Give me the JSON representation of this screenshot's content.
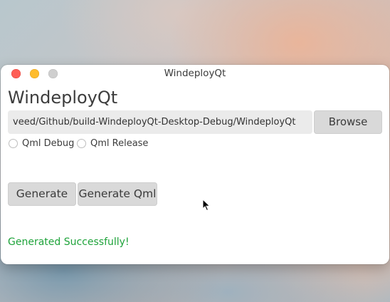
{
  "window": {
    "title": "WindeployQt",
    "controls": {
      "close": "close-icon",
      "minimize": "minimize-icon",
      "maximize": "maximize-icon"
    }
  },
  "main": {
    "heading": "WindeployQt",
    "path_value": "veed/Github/build-WindeployQt-Desktop-Debug/WindeployQt",
    "browse_label": "Browse",
    "options": [
      {
        "label": "Qml Debug",
        "checked": false
      },
      {
        "label": "Qml Release",
        "checked": false
      }
    ],
    "generate_label": "Generate",
    "generate_qml_label": "Generate Qml",
    "status_text": "Generated Successfully!"
  },
  "colors": {
    "close": "#fe5f57",
    "minimize": "#febc2e",
    "maximize": "#cfcfcf",
    "status_success": "#1ea33a",
    "button_bg": "#d9d9d9"
  },
  "cursor": "arrow-cursor-icon"
}
